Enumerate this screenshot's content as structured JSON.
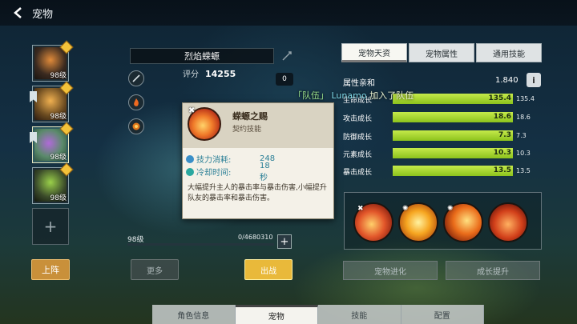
{
  "header": {
    "title": "宠物"
  },
  "roster": {
    "slots": [
      {
        "level": "98级",
        "color": "#6b5a3a"
      },
      {
        "level": "98级",
        "color": "#8a6a2a"
      },
      {
        "level": "98级",
        "color": "#6a7a9a"
      },
      {
        "level": "98级",
        "color": "#4a5a3a"
      }
    ],
    "add_label": "+",
    "deploy_label": "上阵"
  },
  "pet": {
    "name": "烈焰蝾螈",
    "score_label": "评分",
    "score": "14255",
    "count": "0",
    "level": "98级",
    "exp": "0/4680310",
    "exp_fraction": 0.0,
    "more_label": "更多",
    "battle_label": "出战",
    "plus_label": "+"
  },
  "tooltip": {
    "name": "蝾螈之赐",
    "type": "契约技能",
    "close": "✖",
    "cost_label": "技力消耗:",
    "cost_value": "248",
    "cooldown_label": "冷却时间:",
    "cooldown_value": "18秒",
    "description": "大幅提升主人的暴击率与暴击伤害,小幅提升队友的暴击率和暴击伤害。"
  },
  "tabs": [
    "宠物天资",
    "宠物属性",
    "通用技能"
  ],
  "affinity": {
    "label": "属性亲和",
    "value": "1.840",
    "info": "i"
  },
  "stats": [
    {
      "name": "生命成长",
      "value": "135.4",
      "max": "135.4",
      "fraction": 1.0
    },
    {
      "name": "攻击成长",
      "value": "18.6",
      "max": "18.6",
      "fraction": 1.0
    },
    {
      "name": "防御成长",
      "value": "7.3",
      "max": "7.3",
      "fraction": 1.0
    },
    {
      "name": "元素成长",
      "value": "10.3",
      "max": "10.3",
      "fraction": 1.0
    },
    {
      "name": "暴击成长",
      "value": "13.5",
      "max": "13.5",
      "fraction": 1.0
    }
  ],
  "skills": [
    {
      "x": "✖",
      "color": "#d8462a"
    },
    {
      "x": "✺",
      "color": "#f09a20"
    },
    {
      "x": "✺",
      "color": "#e06a18"
    },
    {
      "x": "",
      "color": "#c0381a"
    }
  ],
  "skill_buttons": {
    "evolve": "宠物进化",
    "grow": "成长提升"
  },
  "team_message": {
    "tag": "「队伍」",
    "who": "Lunamo",
    "text": "加入了队伍"
  },
  "bottom_nav": [
    "角色信息",
    "宠物",
    "技能",
    "配置"
  ]
}
